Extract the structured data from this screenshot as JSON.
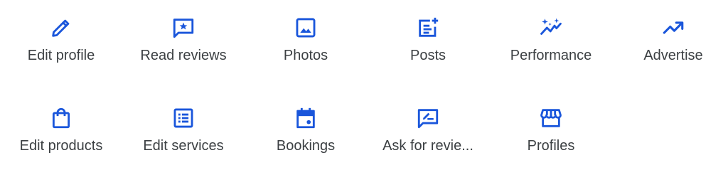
{
  "accent_color": "#1a56db",
  "actions": [
    {
      "label": "Edit profile",
      "icon": "pencil-icon"
    },
    {
      "label": "Read reviews",
      "icon": "review-star-icon"
    },
    {
      "label": "Photos",
      "icon": "photo-icon"
    },
    {
      "label": "Posts",
      "icon": "add-post-icon"
    },
    {
      "label": "Performance",
      "icon": "performance-sparkle-icon"
    },
    {
      "label": "Advertise",
      "icon": "trending-up-icon"
    },
    {
      "label": "Edit products",
      "icon": "shopping-bag-icon"
    },
    {
      "label": "Edit services",
      "icon": "list-icon"
    },
    {
      "label": "Bookings",
      "icon": "calendar-icon"
    },
    {
      "label": "Ask for revie...",
      "icon": "rate-review-icon"
    },
    {
      "label": "Profiles",
      "icon": "storefront-icon"
    }
  ]
}
